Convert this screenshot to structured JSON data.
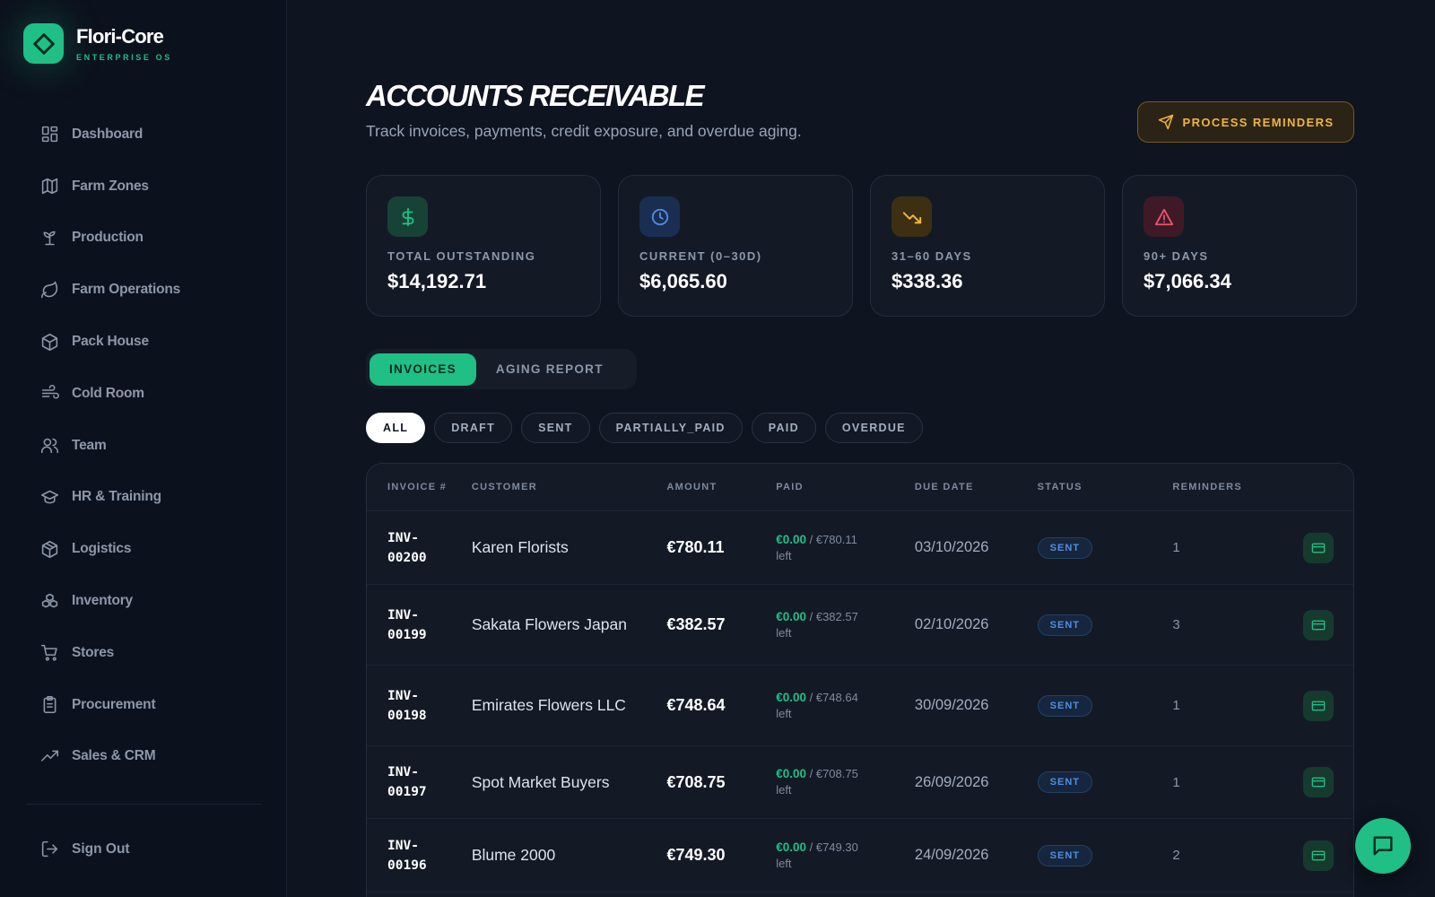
{
  "brand": {
    "name": "Flori-Core",
    "subtitle": "ENTERPRISE OS"
  },
  "sidebar": {
    "items": [
      {
        "label": "Dashboard",
        "icon": "dashboard-icon"
      },
      {
        "label": "Farm Zones",
        "icon": "map-icon"
      },
      {
        "label": "Production",
        "icon": "sprout-icon"
      },
      {
        "label": "Farm Operations",
        "icon": "leaf-icon"
      },
      {
        "label": "Pack House",
        "icon": "package-icon"
      },
      {
        "label": "Cold Room",
        "icon": "wind-icon"
      },
      {
        "label": "Team",
        "icon": "users-icon"
      },
      {
        "label": "HR & Training",
        "icon": "graduation-cap-icon"
      },
      {
        "label": "Logistics",
        "icon": "box-icon"
      },
      {
        "label": "Inventory",
        "icon": "boxes-icon"
      },
      {
        "label": "Stores",
        "icon": "cart-icon"
      },
      {
        "label": "Procurement",
        "icon": "clipboard-icon"
      },
      {
        "label": "Sales & CRM",
        "icon": "trending-up-icon"
      }
    ],
    "sign_out": "Sign Out"
  },
  "header": {
    "title": "ACCOUNTS RECEIVABLE",
    "subtitle": "Track invoices, payments, credit exposure, and overdue aging.",
    "action_label": "PROCESS REMINDERS"
  },
  "cards": [
    {
      "label": "TOTAL OUTSTANDING",
      "value": "$14,192.71",
      "icon": "dollar-icon",
      "accent": "#1fbf85"
    },
    {
      "label": "CURRENT (0–30D)",
      "value": "$6,065.60",
      "icon": "clock-icon",
      "accent": "#4f8fe0"
    },
    {
      "label": "31–60 DAYS",
      "value": "$338.36",
      "icon": "trending-down-icon",
      "accent": "#f2b440"
    },
    {
      "label": "90+ DAYS",
      "value": "$7,066.34",
      "icon": "alert-triangle-icon",
      "accent": "#e8556d"
    }
  ],
  "tabs": [
    {
      "label": "INVOICES",
      "active": true
    },
    {
      "label": "AGING REPORT",
      "active": false
    }
  ],
  "filters": [
    "ALL",
    "DRAFT",
    "SENT",
    "PARTIALLY_PAID",
    "PAID",
    "OVERDUE"
  ],
  "table": {
    "columns": [
      "INVOICE #",
      "CUSTOMER",
      "AMOUNT",
      "PAID",
      "DUE DATE",
      "STATUS",
      "REMINDERS"
    ],
    "rows": [
      {
        "inv_a": "INV-",
        "inv_b": "00200",
        "customer": "Karen Florists",
        "amount": "€780.11",
        "paid": "€0.00",
        "paid_of": "/ €780.11",
        "left": "left",
        "due": "03/10/2026",
        "status": "SENT",
        "reminders": "1"
      },
      {
        "inv_a": "INV-",
        "inv_b": "00199",
        "customer": "Sakata Flowers Japan",
        "amount": "€382.57",
        "paid": "€0.00",
        "paid_of": "/ €382.57",
        "left": "left",
        "due": "02/10/2026",
        "status": "SENT",
        "reminders": "3"
      },
      {
        "inv_a": "INV-",
        "inv_b": "00198",
        "customer": "Emirates Flowers LLC",
        "amount": "€748.64",
        "paid": "€0.00",
        "paid_of": "/ €748.64",
        "left": "left",
        "due": "30/09/2026",
        "status": "SENT",
        "reminders": "1"
      },
      {
        "inv_a": "INV-",
        "inv_b": "00197",
        "customer": "Spot Market Buyers",
        "amount": "€708.75",
        "paid": "€0.00",
        "paid_of": "/ €708.75",
        "left": "left",
        "due": "26/09/2026",
        "status": "SENT",
        "reminders": "1"
      },
      {
        "inv_a": "INV-",
        "inv_b": "00196",
        "customer": "Blume 2000",
        "amount": "€749.30",
        "paid": "€0.00",
        "paid_of": "/ €749.30",
        "left": "left",
        "due": "24/09/2026",
        "status": "SENT",
        "reminders": "2"
      }
    ]
  },
  "colors": {
    "accent": "#1fbf85",
    "background": "#0e1420",
    "warning": "#f2b440",
    "danger": "#e8556d",
    "info": "#4f8fe0"
  }
}
